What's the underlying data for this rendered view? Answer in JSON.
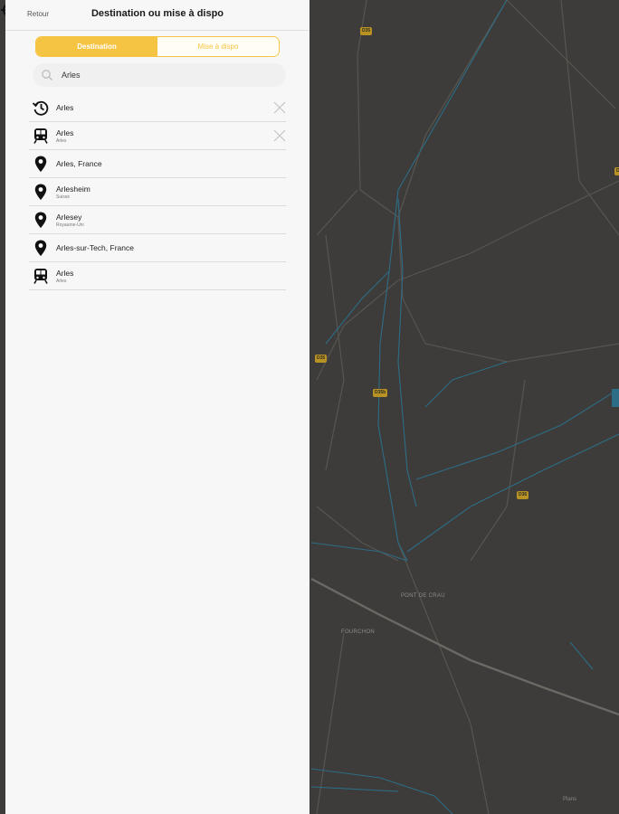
{
  "header": {
    "back_label": "Retour",
    "title": "Destination ou mise à dispo"
  },
  "tabs": [
    {
      "label": "Destination",
      "active": true
    },
    {
      "label": "Mise à dispo",
      "active": false
    }
  ],
  "search": {
    "value": "Arles",
    "placeholder": ""
  },
  "results": [
    {
      "icon": "history-icon",
      "title": "Arles",
      "subtitle": "",
      "deletable": true
    },
    {
      "icon": "train-icon",
      "title": "Arles",
      "subtitle": "Arles",
      "deletable": true
    },
    {
      "icon": "location-pin-icon",
      "title": "Arles, France",
      "subtitle": "",
      "deletable": false
    },
    {
      "icon": "location-pin-icon",
      "title": "Arlesheim",
      "subtitle": "Suisse",
      "deletable": false
    },
    {
      "icon": "location-pin-icon",
      "title": "Arlesey",
      "subtitle": "Royaume-Uni",
      "deletable": false
    },
    {
      "icon": "location-pin-icon",
      "title": "Arles-sur-Tech, France",
      "subtitle": "",
      "deletable": false
    },
    {
      "icon": "train-icon",
      "title": "Arles",
      "subtitle": "Arles",
      "deletable": false
    }
  ],
  "map": {
    "road_labels": [
      "D35",
      "D35",
      "D35b",
      "D36",
      "D3"
    ],
    "places": [
      "PONT DE CRAU",
      "FOURCHON"
    ],
    "legal": "Plans"
  },
  "colors": {
    "accent": "#f5c443",
    "panel_bg": "#f7f7f7",
    "map_bg": "#3d3c3a"
  }
}
